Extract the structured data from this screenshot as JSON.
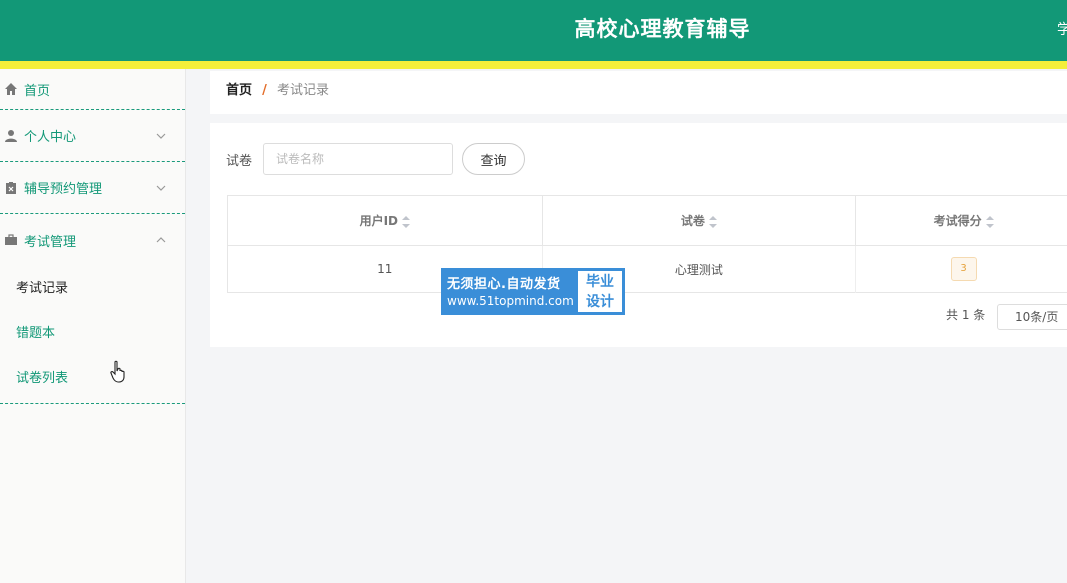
{
  "header": {
    "title": "高校心理教育辅导",
    "right_text": "学"
  },
  "sidebar": {
    "items": [
      {
        "label": "首页",
        "icon": "home-icon"
      },
      {
        "label": "个人中心",
        "icon": "user-icon"
      },
      {
        "label": "辅导预约管理",
        "icon": "clipboard-icon"
      },
      {
        "label": "考试管理",
        "icon": "briefcase-icon"
      }
    ],
    "submenu": [
      {
        "label": "考试记录"
      },
      {
        "label": "错题本"
      },
      {
        "label": "试卷列表"
      }
    ]
  },
  "breadcrumb": {
    "home": "首页",
    "separator": "/",
    "current": "考试记录"
  },
  "search": {
    "label": "试卷",
    "placeholder": "试卷名称",
    "button": "查询"
  },
  "table": {
    "columns": [
      "用户ID",
      "试卷",
      "考试得分"
    ],
    "rows": [
      {
        "user_id": "11",
        "paper": "心理测试",
        "score": "3"
      }
    ]
  },
  "pagination": {
    "total": "共 1 条",
    "page_size": "10条/页"
  },
  "watermark": {
    "line1": "无须担心.自动发货",
    "line2": "www.51topmind.com",
    "tag1": "毕业",
    "tag2": "设计"
  },
  "colors": {
    "primary": "#129877",
    "accent_bar": "#f4ef3a",
    "watermark": "#3a8ed8"
  }
}
